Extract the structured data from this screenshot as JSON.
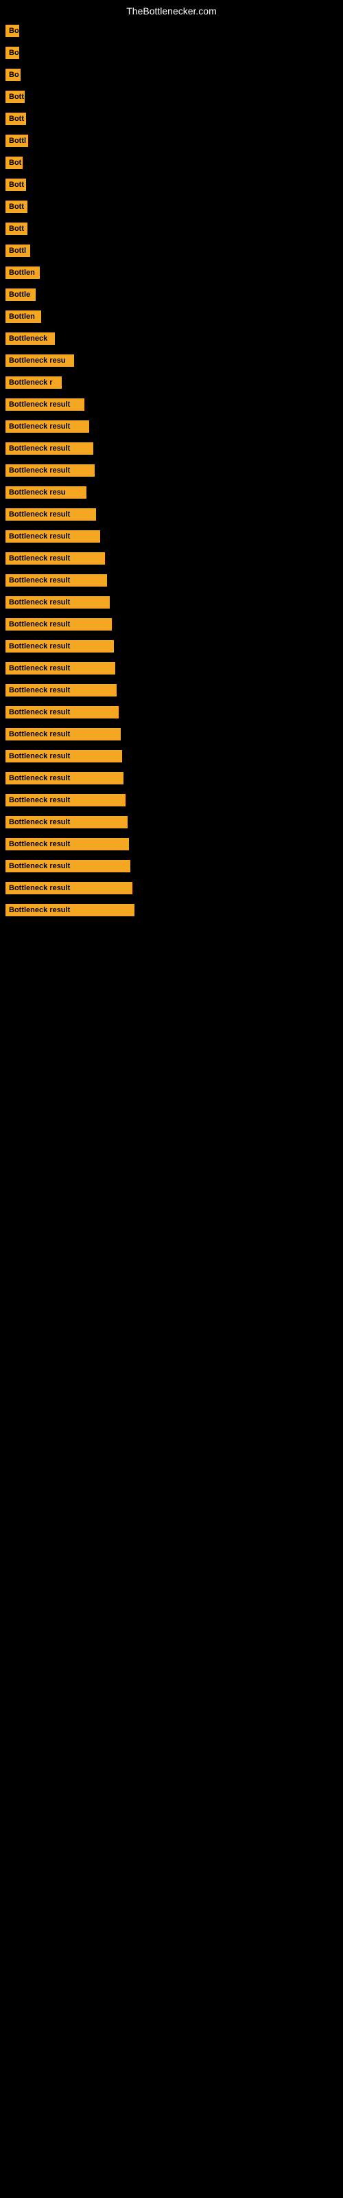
{
  "site": {
    "title": "TheBottlenecker.com"
  },
  "items": [
    {
      "label": "Bo",
      "width": 20
    },
    {
      "label": "Bo",
      "width": 20
    },
    {
      "label": "Bo",
      "width": 22
    },
    {
      "label": "Bott",
      "width": 28
    },
    {
      "label": "Bott",
      "width": 30
    },
    {
      "label": "Bottl",
      "width": 33
    },
    {
      "label": "Bot",
      "width": 25
    },
    {
      "label": "Bott",
      "width": 30
    },
    {
      "label": "Bott",
      "width": 32
    },
    {
      "label": "Bott",
      "width": 32
    },
    {
      "label": "Bottl",
      "width": 36
    },
    {
      "label": "Bottlen",
      "width": 50
    },
    {
      "label": "Bottle",
      "width": 44
    },
    {
      "label": "Bottlen",
      "width": 52
    },
    {
      "label": "Bottleneck",
      "width": 72
    },
    {
      "label": "Bottleneck resu",
      "width": 100
    },
    {
      "label": "Bottleneck r",
      "width": 82
    },
    {
      "label": "Bottleneck result",
      "width": 115
    },
    {
      "label": "Bottleneck result",
      "width": 122
    },
    {
      "label": "Bottleneck result",
      "width": 128
    },
    {
      "label": "Bottleneck result",
      "width": 130
    },
    {
      "label": "Bottleneck resu",
      "width": 118
    },
    {
      "label": "Bottleneck result",
      "width": 132
    },
    {
      "label": "Bottleneck result",
      "width": 138
    },
    {
      "label": "Bottleneck result",
      "width": 145
    },
    {
      "label": "Bottleneck result",
      "width": 148
    },
    {
      "label": "Bottleneck result",
      "width": 152
    },
    {
      "label": "Bottleneck result",
      "width": 155
    },
    {
      "label": "Bottleneck result",
      "width": 158
    },
    {
      "label": "Bottleneck result",
      "width": 160
    },
    {
      "label": "Bottleneck result",
      "width": 162
    },
    {
      "label": "Bottleneck result",
      "width": 165
    },
    {
      "label": "Bottleneck result",
      "width": 168
    },
    {
      "label": "Bottleneck result",
      "width": 170
    },
    {
      "label": "Bottleneck result",
      "width": 172
    },
    {
      "label": "Bottleneck result",
      "width": 175
    },
    {
      "label": "Bottleneck result",
      "width": 178
    },
    {
      "label": "Bottleneck result",
      "width": 180
    },
    {
      "label": "Bottleneck result",
      "width": 182
    },
    {
      "label": "Bottleneck result",
      "width": 185
    },
    {
      "label": "Bottleneck result",
      "width": 188
    }
  ]
}
